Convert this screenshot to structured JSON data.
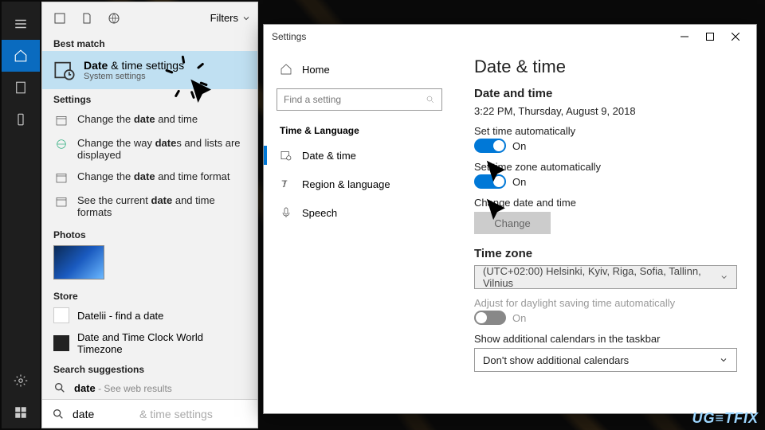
{
  "rail": {
    "items": [
      "menu",
      "home",
      "tablet",
      "phone"
    ],
    "bottom": [
      "gear",
      "start"
    ]
  },
  "search": {
    "top": {
      "filters_label": "Filters"
    },
    "best_match_label": "Best match",
    "best_match": {
      "title_pre": "Date",
      "title_post": " & time settings",
      "subtitle": "System settings"
    },
    "settings_label": "Settings",
    "results": [
      {
        "pre": "Change the ",
        "bold": "date",
        "post": " and time"
      },
      {
        "pre": "Change the way ",
        "bold": "date",
        "post": "s and lists are displayed"
      },
      {
        "pre": "Change the ",
        "bold": "date",
        "post": " and time format"
      },
      {
        "pre": "See the current ",
        "bold": "date",
        "post": " and time formats"
      }
    ],
    "photos_label": "Photos",
    "store_label": "Store",
    "store_items": [
      {
        "label": "Datelii - find a date"
      },
      {
        "label": "Date and Time Clock World Timezone"
      }
    ],
    "suggest_label": "Search suggestions",
    "suggest": {
      "bold": "date",
      "sub": " - See web results"
    },
    "box": {
      "value": "date ",
      "placeholder": "& time settings"
    }
  },
  "settings_win": {
    "title": "Settings",
    "nav": {
      "home": "Home",
      "find_placeholder": "Find a setting",
      "group": "Time & Language",
      "items": [
        {
          "label": "Date & time",
          "selected": true
        },
        {
          "label": "Region & language"
        },
        {
          "label": "Speech"
        }
      ]
    },
    "content": {
      "h1": "Date & time",
      "h2": "Date and time",
      "now": "3:22 PM, Thursday, August 9, 2018",
      "auto_time_label": "Set time automatically",
      "auto_tz_label": "Set time zone automatically",
      "on": "On",
      "change_label": "Change date and time",
      "change_btn": "Change",
      "tz_label": "Time zone",
      "tz_value": "(UTC+02:00) Helsinki, Kyiv, Riga, Sofia, Tallinn, Vilnius",
      "dst_label": "Adjust for daylight saving time automatically",
      "cal_label": "Show additional calendars in the taskbar",
      "cal_value": "Don't show additional calendars"
    }
  },
  "watermark": "UG≡TFIX"
}
